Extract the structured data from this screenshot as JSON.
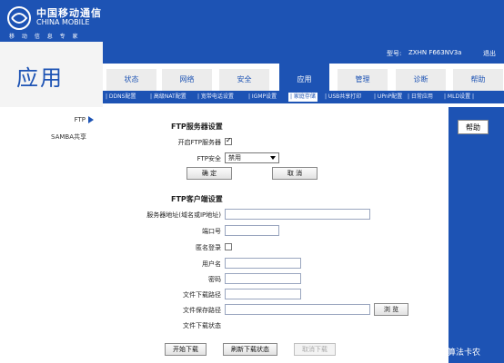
{
  "brand": {
    "name_cn": "中国移动通信",
    "name_en": "CHINA MOBILE",
    "slogan": "移 动 信 息 专 家"
  },
  "page": {
    "title": "应用"
  },
  "info": {
    "model_label": "型号:",
    "model_value": "ZXHN F663NV3a",
    "logout": "退出"
  },
  "nav": {
    "tabs": [
      {
        "label": "状态"
      },
      {
        "label": "网络"
      },
      {
        "label": "安全"
      },
      {
        "label": "应用",
        "active": true
      },
      {
        "label": "管理"
      },
      {
        "label": "诊断"
      },
      {
        "label": "帮助"
      }
    ]
  },
  "subnav": {
    "items": [
      {
        "label": "| DDNS配置"
      },
      {
        "label": "| 高级NAT配置"
      },
      {
        "label": "| 宽带电话设置"
      },
      {
        "label": "| IGMP设置"
      },
      {
        "label": "| 家庭存储",
        "active": true
      },
      {
        "label": "| USB共享打印"
      },
      {
        "label": "| UPnP配置"
      },
      {
        "label": "| 日常应用"
      },
      {
        "label": "| MLD设置 |"
      }
    ]
  },
  "sidebar": {
    "items": [
      {
        "label": "FTP",
        "active": true
      },
      {
        "label": "SAMBA共享"
      }
    ]
  },
  "help_label": "帮助",
  "ftp_server": {
    "title": "FTP服务器设置",
    "enable_label": "开启FTP服务器",
    "enable_checked": true,
    "security_label": "FTP安全",
    "security_value": "禁用",
    "confirm_label": "确 定",
    "cancel_label": "取 消"
  },
  "ftp_client": {
    "title": "FTP客户端设置",
    "server_label": "服务器地址(域名或IP地址)",
    "port_label": "端口号",
    "anon_label": "匿名登录",
    "anon_checked": false,
    "user_label": "用户名",
    "password_label": "密码",
    "download_path_label": "文件下载路径",
    "save_path_label": "文件保存路径",
    "browse_label": "浏 览",
    "status_label": "文件下载状态",
    "start_label": "开始下载",
    "refresh_label": "刷新下载状态",
    "cancel_download_label": "取消下载"
  },
  "watermark": "算法卡农",
  "colors": {
    "brand_blue": "#1d53b4"
  }
}
